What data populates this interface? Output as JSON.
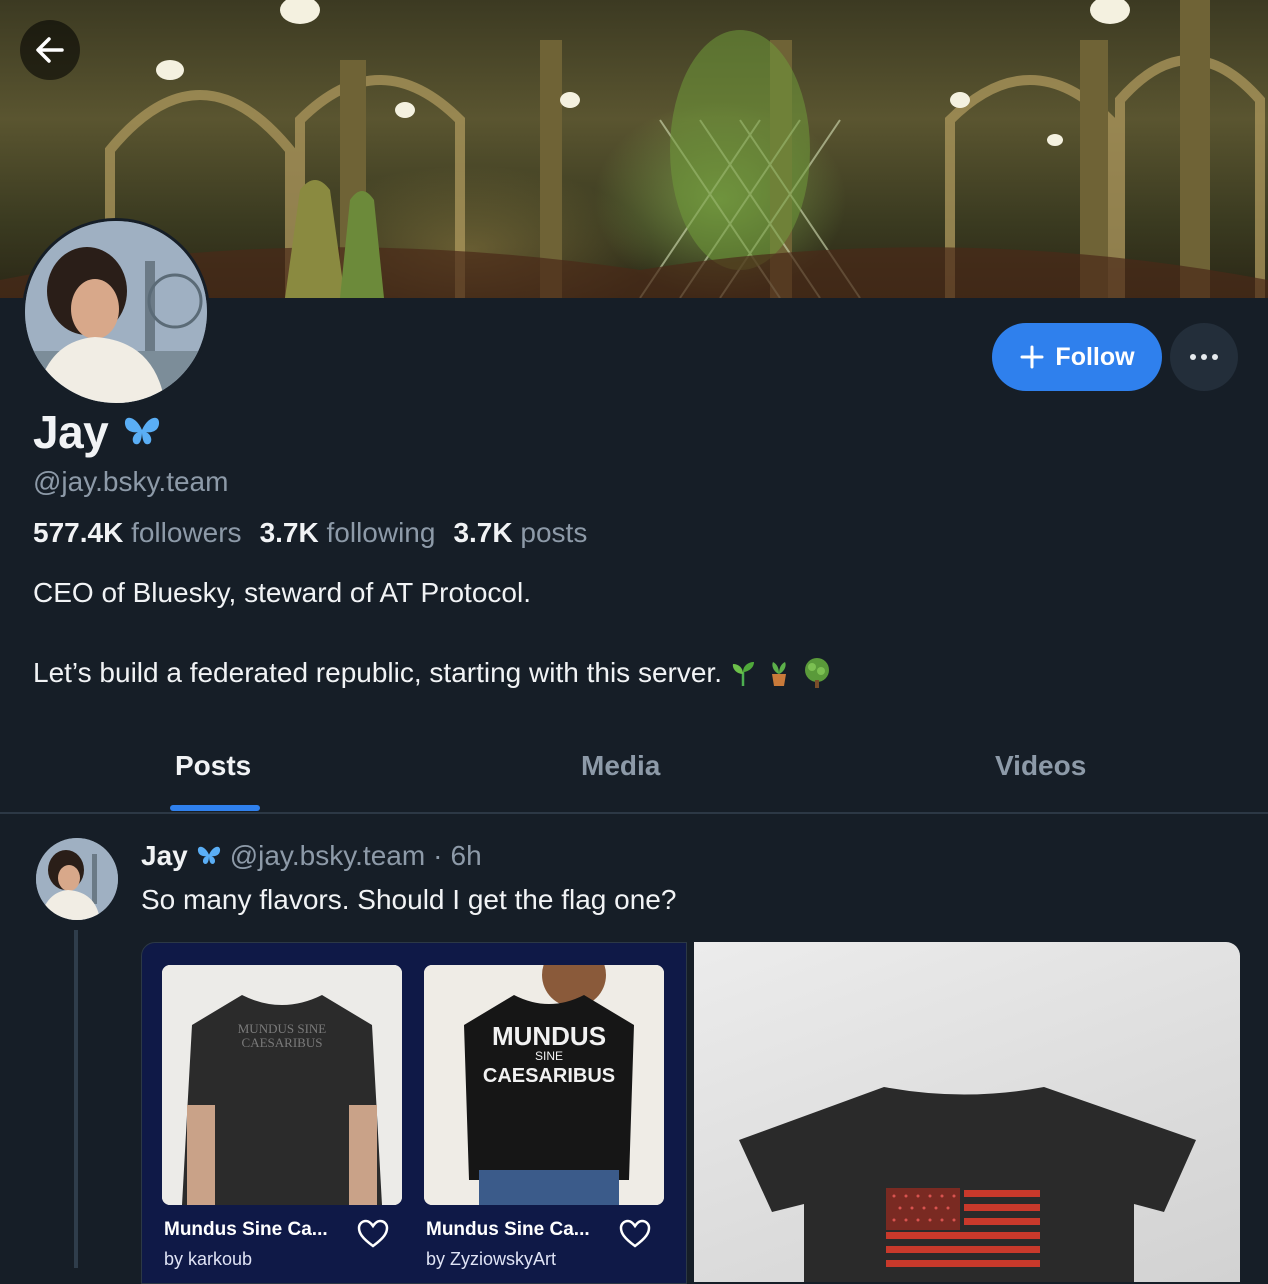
{
  "profile": {
    "display_name": "Jay",
    "handle": "@jay.bsky.team",
    "followers_count": "577.4K",
    "followers_label": "followers",
    "following_count": "3.7K",
    "following_label": "following",
    "posts_count": "3.7K",
    "posts_label": "posts",
    "bio_line1": "CEO of Bluesky, steward of AT Protocol.",
    "bio_line2": "Let’s build a federated republic, starting with this server.",
    "bio_emojis": [
      "seedling",
      "potted-plant",
      "tree"
    ]
  },
  "actions": {
    "follow_label": "Follow",
    "more_label": "···"
  },
  "tabs": [
    {
      "label": "Posts",
      "active": true
    },
    {
      "label": "Media",
      "active": false
    },
    {
      "label": "Videos",
      "active": false
    }
  ],
  "post": {
    "author_name": "Jay",
    "author_handle": "@jay.bsky.team",
    "time": "6h",
    "text": "So many flavors. Should I get the flag one?",
    "products": [
      {
        "title": "Mundus Sine Ca...",
        "by": "by karkoub",
        "shirt_text": "MUNDUS SINE CAESARIBUS"
      },
      {
        "title": "Mundus Sine Ca...",
        "by": "by ZyziowskyArt",
        "shirt_text_1": "MUNDUS",
        "shirt_text_2": "SINE",
        "shirt_text_3": "CAESARIBUS"
      }
    ]
  },
  "colors": {
    "background": "#161e27",
    "accent": "#2f80ed",
    "muted_text": "#8d9aa8",
    "verified_badge": "#5aaef5"
  }
}
